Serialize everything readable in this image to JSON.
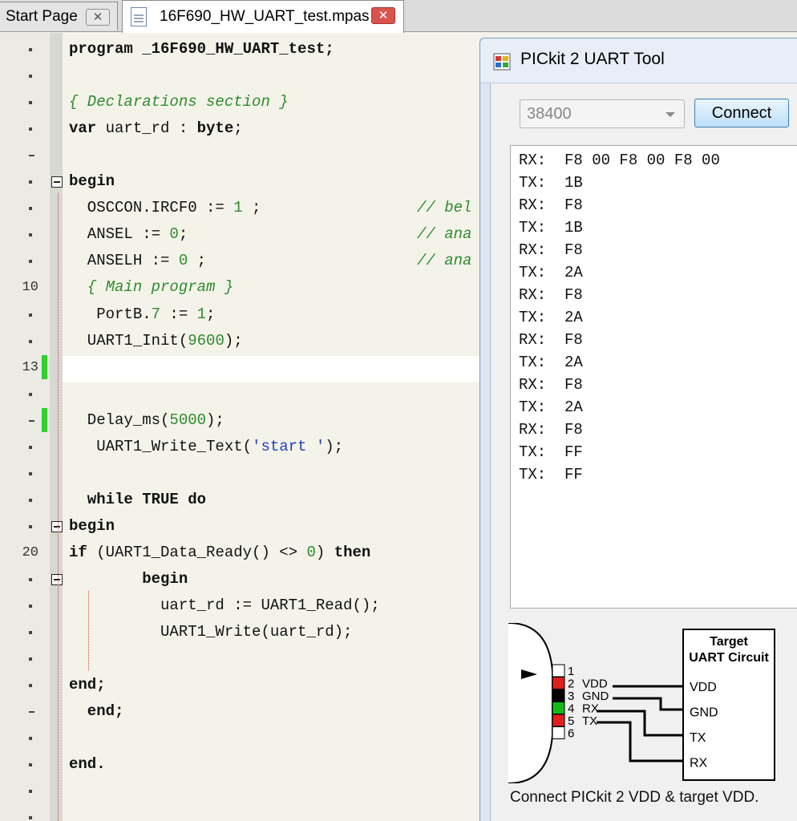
{
  "tabs": [
    {
      "label": "Start Page",
      "close_icon": "close-icon"
    },
    {
      "label": "16F690_HW_UART_test.mpas",
      "close_icon": "close-icon"
    }
  ],
  "editor": {
    "gutter_numbers": [
      {
        "line": 10,
        "label": "10"
      },
      {
        "line": 13,
        "label": "13"
      },
      {
        "line": 20,
        "label": "20"
      }
    ],
    "lines": [
      {
        "seg": [
          {
            "t": "program _16F690_HW_UART_test;",
            "c": "kw0"
          }
        ]
      },
      {
        "seg": []
      },
      {
        "seg": [
          {
            "t": "{ Declarations section }",
            "c": "cm"
          }
        ]
      },
      {
        "seg": [
          {
            "t": "var uart_rd : byte;",
            "c": ""
          }
        ]
      },
      {
        "seg": []
      },
      {
        "seg": [
          {
            "t": "begin",
            "c": "kw"
          }
        ]
      },
      {
        "seg": [
          {
            "t": "  OSCCON.IRCF0 := ",
            "c": ""
          },
          {
            "t": "1",
            "c": "nm"
          },
          {
            "t": " ;",
            "c": ""
          }
        ],
        "right": "// bel"
      },
      {
        "seg": [
          {
            "t": "  ANSEL := ",
            "c": ""
          },
          {
            "t": "0",
            "c": "nm"
          },
          {
            "t": ";",
            "c": ""
          }
        ],
        "right": "// ana"
      },
      {
        "seg": [
          {
            "t": "  ANSELH := ",
            "c": ""
          },
          {
            "t": "0",
            "c": "nm"
          },
          {
            "t": " ;",
            "c": ""
          }
        ],
        "right": "// ana"
      },
      {
        "seg": [
          {
            "t": "  { Main program }",
            "c": "cm"
          }
        ]
      },
      {
        "seg": [
          {
            "t": "   PortB.",
            "c": ""
          },
          {
            "t": "7",
            "c": "nm"
          },
          {
            "t": " := ",
            "c": ""
          },
          {
            "t": "1",
            "c": "nm"
          },
          {
            "t": ";",
            "c": ""
          }
        ]
      },
      {
        "seg": [
          {
            "t": "  UART1_Init(",
            "c": ""
          },
          {
            "t": "9600",
            "c": "nm"
          },
          {
            "t": ");",
            "c": ""
          }
        ]
      },
      {
        "seg": []
      },
      {
        "seg": []
      },
      {
        "seg": [
          {
            "t": "  Delay_ms(",
            "c": ""
          },
          {
            "t": "5000",
            "c": "nm"
          },
          {
            "t": ");",
            "c": ""
          }
        ]
      },
      {
        "seg": [
          {
            "t": "   UART1_Write_Text(",
            "c": ""
          },
          {
            "t": "'start '",
            "c": "st"
          },
          {
            "t": ");",
            "c": ""
          }
        ]
      },
      {
        "seg": []
      },
      {
        "seg": [
          {
            "t": "  while TRUE do",
            "c": "kw"
          }
        ]
      },
      {
        "seg": [
          {
            "t": "begin",
            "c": "kw"
          }
        ]
      },
      {
        "seg": [
          {
            "t": "if",
            "c": "kw"
          },
          {
            "t": " (UART1_Data_Ready() <> ",
            "c": ""
          },
          {
            "t": "0",
            "c": "nm"
          },
          {
            "t": ") ",
            "c": ""
          },
          {
            "t": "then",
            "c": "kw"
          }
        ]
      },
      {
        "seg": [
          {
            "t": "        begin",
            "c": "kw"
          }
        ]
      },
      {
        "seg": [
          {
            "t": "          uart_rd := UART1_Read();",
            "c": ""
          }
        ]
      },
      {
        "seg": [
          {
            "t": "          UART1_Write(uart_rd);",
            "c": ""
          }
        ]
      },
      {
        "seg": []
      },
      {
        "seg": [
          {
            "t": "end;",
            "c": "kw"
          }
        ]
      },
      {
        "seg": [
          {
            "t": "  end;",
            "c": "kw"
          }
        ]
      },
      {
        "seg": []
      },
      {
        "seg": [
          {
            "t": "end.",
            "c": "kw"
          }
        ]
      }
    ]
  },
  "uart_tool": {
    "title": "PICkit 2 UART Tool",
    "app_icon": "app-window-icon",
    "baud": "38400",
    "connect_label": "Connect",
    "terminal": [
      "RX:  F8 00 F8 00 F8 00",
      "TX:  1B",
      "RX:  F8",
      "TX:  1B",
      "RX:  F8",
      "TX:  2A",
      "RX:  F8",
      "TX:  2A",
      "RX:  F8",
      "TX:  2A",
      "RX:  F8",
      "TX:  2A",
      "RX:  F8",
      "TX:  FF",
      "TX:  FF"
    ],
    "diagram": {
      "pins": [
        "1",
        "2",
        "3",
        "4",
        "5",
        "6"
      ],
      "pin_labels": [
        "VDD",
        "GND",
        "RX",
        "TX"
      ],
      "target_title_1": "Target",
      "target_title_2": "UART Circuit",
      "target_pins": [
        "VDD",
        "GND",
        "TX",
        "RX"
      ]
    },
    "hint": "Connect PICkit 2 VDD & target VDD."
  }
}
